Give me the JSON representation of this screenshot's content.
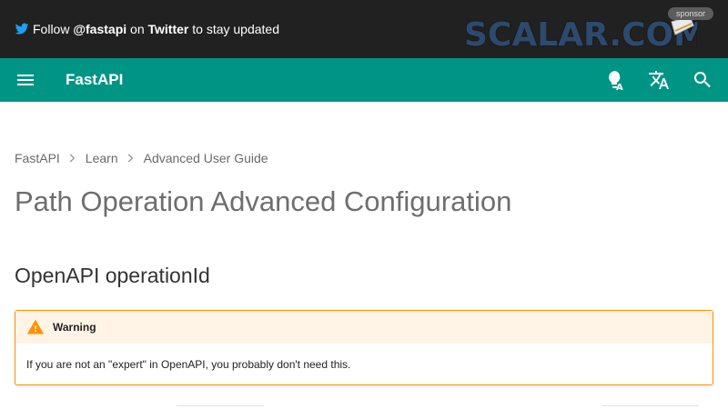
{
  "announcement": {
    "prefix": "Follow ",
    "handle": "@fastapi",
    "middle": " on ",
    "platform": "Twitter",
    "suffix": " to stay updated",
    "icon": "twitter-icon",
    "color": "#1da1f2"
  },
  "sponsor": {
    "logo_text": "SCALAR.COM",
    "badge": "sponsor"
  },
  "header": {
    "site_title": "FastAPI",
    "color": "#009485",
    "icons": [
      "menu-icon",
      "color-palette-icon",
      "translate-icon",
      "search-icon"
    ]
  },
  "breadcrumb": [
    "FastAPI",
    "Learn",
    "Advanced User Guide"
  ],
  "page_title": "Path Operation Advanced Configuration",
  "section_title": "OpenAPI operationId",
  "admonition": {
    "title": "Warning",
    "text": "If you are not an \"expert\" in OpenAPI, you probably don't need this.",
    "accent": "#ff9100",
    "icon": "warning-icon"
  }
}
